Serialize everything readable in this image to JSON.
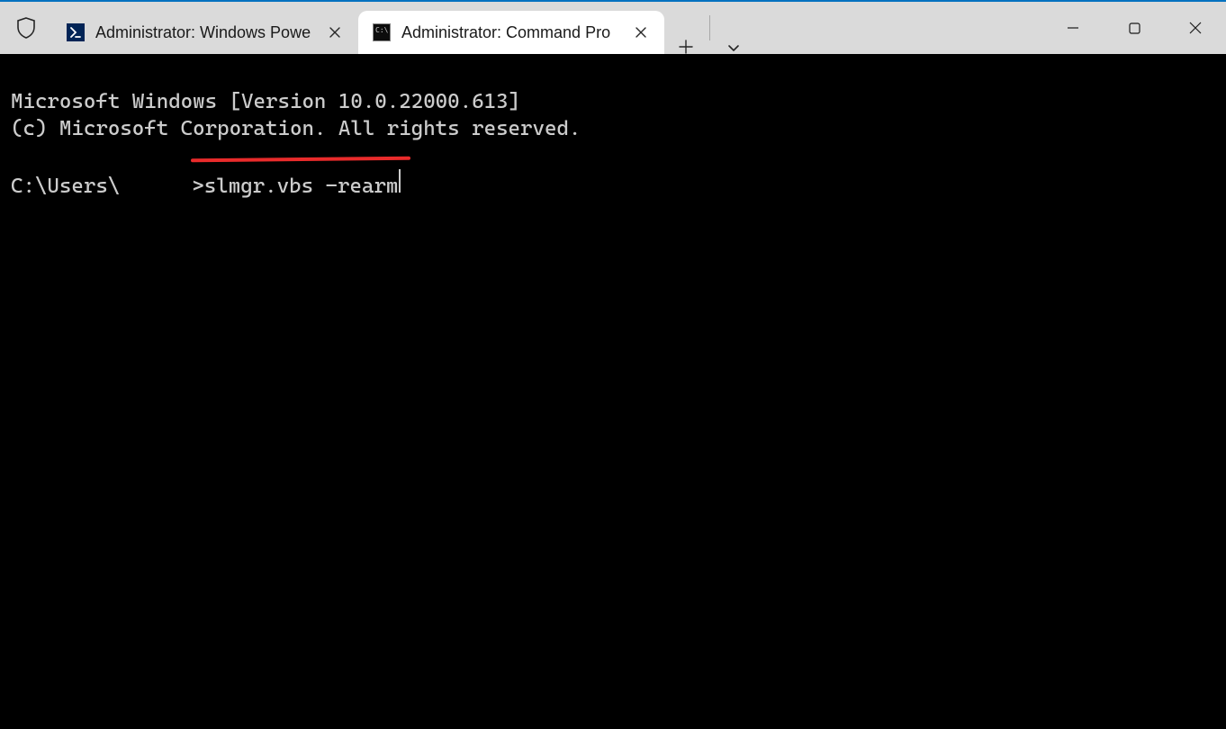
{
  "titlebar": {
    "tabs": [
      {
        "title": "Administrator: Windows Powe",
        "icon": "powershell-icon",
        "active": false
      },
      {
        "title": "Administrator: Command Pro",
        "icon": "cmd-icon",
        "active": true
      }
    ]
  },
  "terminal": {
    "line1": "Microsoft Windows [Version 10.0.22000.613]",
    "line2": "(c) Microsoft Corporation. All rights reserved.",
    "prompt_prefix": "C:\\Users\\",
    "prompt_suffix": ">",
    "command": "slmgr.vbs -rearm"
  },
  "annotation": {
    "underline_color": "#e92b2b"
  }
}
